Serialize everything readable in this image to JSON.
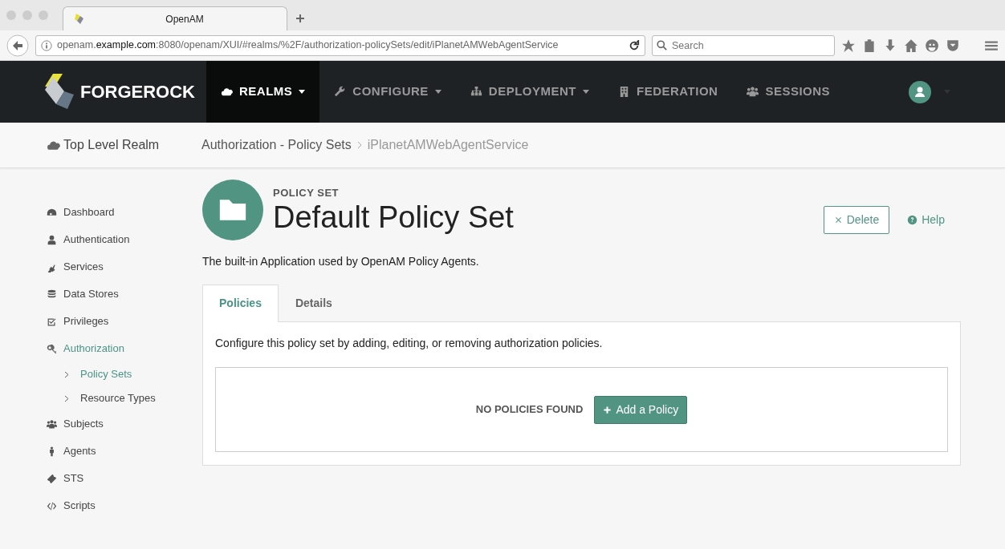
{
  "browser": {
    "tab_title": "OpenAM",
    "url": "openam.**example.com**:8080/openam/XUI/#realms/%2F/authorization-policySets/edit/iPlanetAMWebAgentService",
    "search_placeholder": "Search"
  },
  "navbar": {
    "brand": "FORGEROCK",
    "items": [
      {
        "label": "REALMS",
        "dropdown": true,
        "selected": true
      },
      {
        "label": "CONFIGURE",
        "dropdown": true,
        "selected": false
      },
      {
        "label": "DEPLOYMENT",
        "dropdown": true,
        "selected": false
      },
      {
        "label": "FEDERATION",
        "dropdown": false,
        "selected": false
      },
      {
        "label": "SESSIONS",
        "dropdown": false,
        "selected": false
      }
    ]
  },
  "breadcrumb": {
    "realm": "Top Level Realm",
    "path": [
      "Authorization - Policy Sets",
      "iPlanetAMWebAgentService"
    ]
  },
  "sidebar": {
    "items": [
      {
        "label": "Dashboard",
        "selected": false
      },
      {
        "label": "Authentication",
        "selected": false
      },
      {
        "label": "Services",
        "selected": false
      },
      {
        "label": "Data Stores",
        "selected": false
      },
      {
        "label": "Privileges",
        "selected": false
      },
      {
        "label": "Authorization",
        "selected": true,
        "children": [
          {
            "label": "Policy Sets",
            "selected": true
          },
          {
            "label": "Resource Types",
            "selected": false
          }
        ]
      },
      {
        "label": "Subjects",
        "selected": false
      },
      {
        "label": "Agents",
        "selected": false
      },
      {
        "label": "STS",
        "selected": false
      },
      {
        "label": "Scripts",
        "selected": false
      }
    ]
  },
  "header": {
    "eyebrow": "POLICY SET",
    "title": "Default Policy Set",
    "description": "The built-in Application used by OpenAM Policy Agents.",
    "buttons": [
      {
        "label": "Delete",
        "kind": "outline"
      },
      {
        "label": "Help",
        "kind": "link"
      }
    ]
  },
  "tabs": [
    {
      "label": "Policies",
      "selected": true
    },
    {
      "label": "Details",
      "selected": false
    }
  ],
  "panel": {
    "intro": "Configure this policy set by adding, editing, or removing authorization policies.",
    "empty_text": "NO POLICIES FOUND",
    "add_button": "Add a Policy"
  }
}
